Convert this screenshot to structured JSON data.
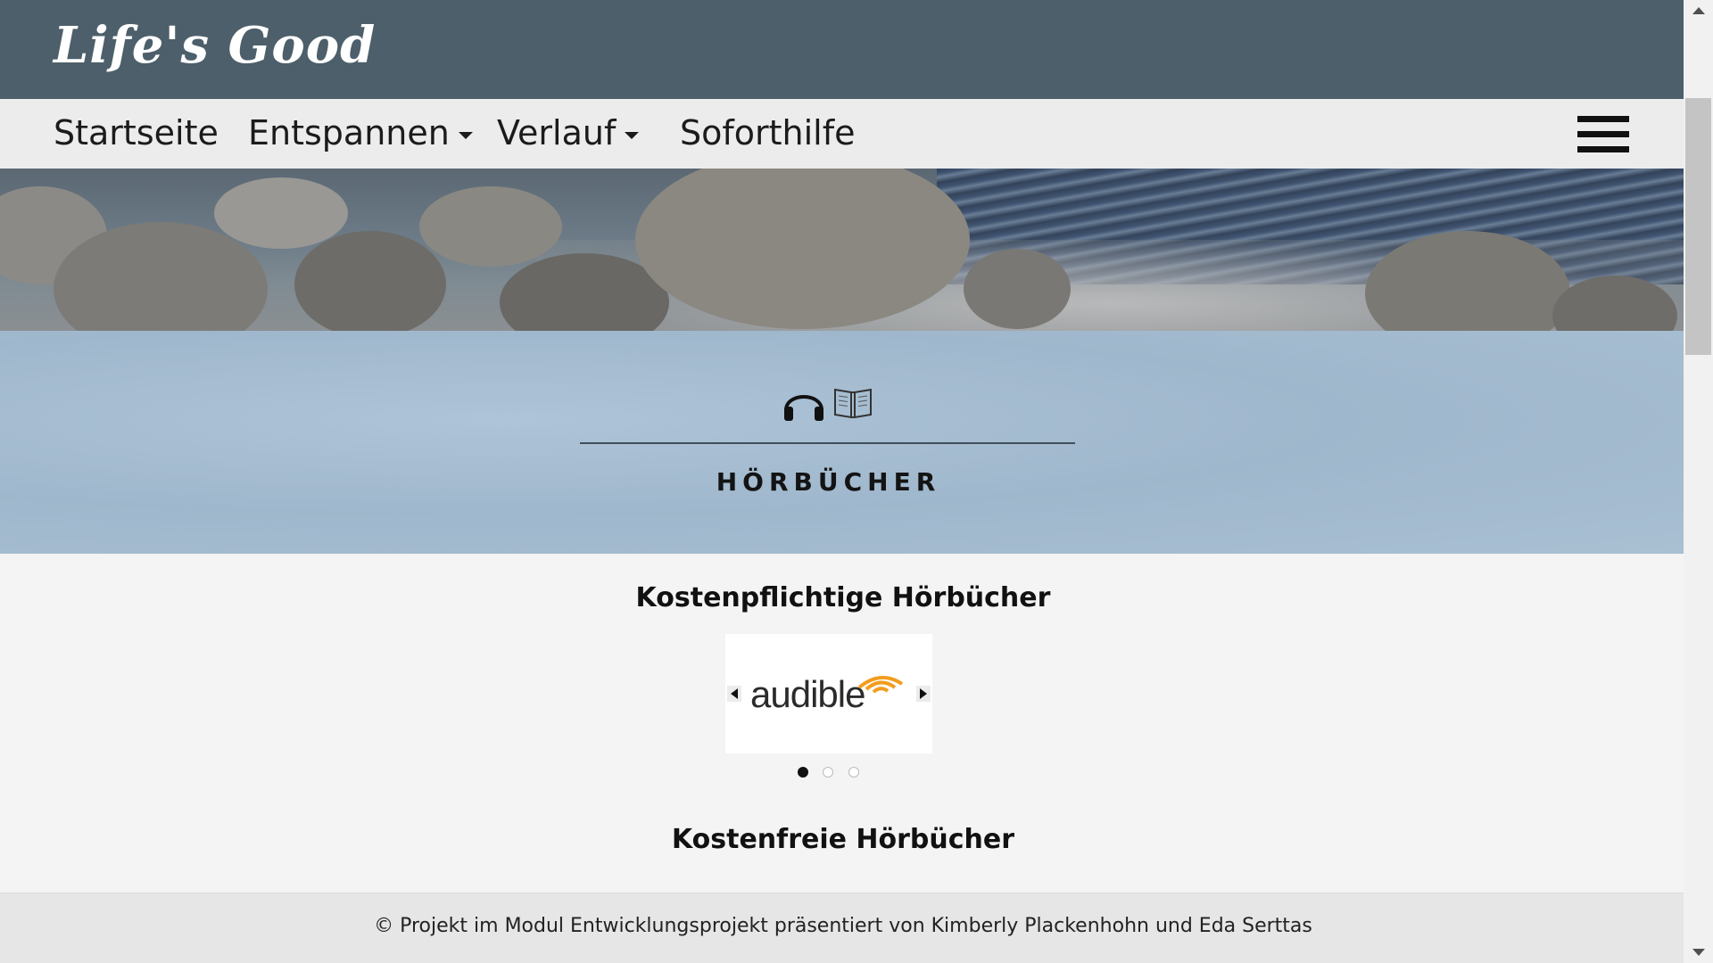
{
  "brand": {
    "name": "Life's Good"
  },
  "nav": {
    "items": [
      {
        "label": "Startseite",
        "dropdown": false
      },
      {
        "label": "Entspannen",
        "dropdown": true
      },
      {
        "label": "Verlauf",
        "dropdown": true
      },
      {
        "label": "Soforthilfe",
        "dropdown": false
      }
    ],
    "menu_icon": "hamburger-menu-icon"
  },
  "hero": {
    "image": "pebble-beach-photo"
  },
  "section": {
    "icons": [
      "headphones-icon",
      "open-book-icon"
    ],
    "title": "HÖRBÜCHER"
  },
  "paid": {
    "heading": "Kostenpflichtige Hörbücher",
    "carousel": {
      "slide_logo_text": "audible",
      "slide_count": 3,
      "active_slide": 1,
      "prev_icon": "arrow-left-icon",
      "next_icon": "arrow-right-icon"
    }
  },
  "free": {
    "heading": "Kostenfreie Hörbücher"
  },
  "footer": {
    "text": "© Projekt im Modul Entwicklungsprojekt präsentiert von Kimberly Plackenhohn und Eda Serttas"
  },
  "colors": {
    "header_bg": "#4c5f6a",
    "nav_bg": "#ececec",
    "band_bg": "#a9c0d3",
    "audible_orange": "#f29d1e"
  }
}
